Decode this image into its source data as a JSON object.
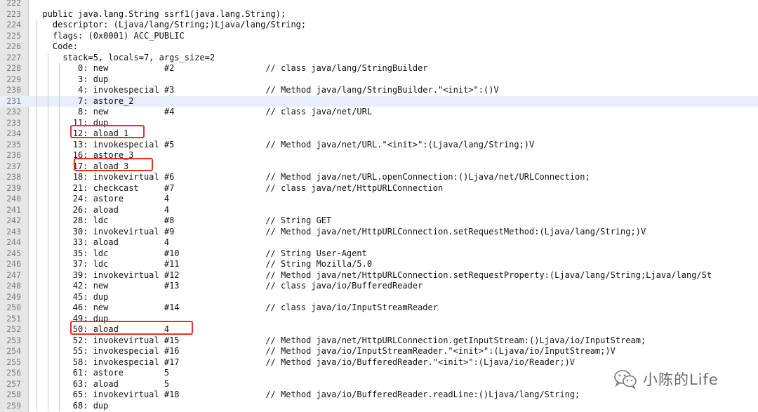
{
  "editor": {
    "lines": [
      {
        "num": "222",
        "text": ""
      },
      {
        "num": "223",
        "text": "  public java.lang.String ssrf1(java.lang.String);"
      },
      {
        "num": "224",
        "text": "    descriptor: (Ljava/lang/String;)Ljava/lang/String;"
      },
      {
        "num": "225",
        "text": "    flags: (0x0001) ACC_PUBLIC"
      },
      {
        "num": "226",
        "text": "    Code:"
      },
      {
        "num": "227",
        "text": "      stack=5, locals=7, args_size=2"
      },
      {
        "num": "228",
        "text": "         0: new           #2                  // class java/lang/StringBuilder"
      },
      {
        "num": "229",
        "text": "         3: dup"
      },
      {
        "num": "230",
        "text": "         4: invokespecial #3                  // Method java/lang/StringBuilder.\"<init>\":()V"
      },
      {
        "num": "231",
        "text": "         7: astore_2"
      },
      {
        "num": "232",
        "text": "         8: new           #4                  // class java/net/URL"
      },
      {
        "num": "233",
        "text": "        11: dup"
      },
      {
        "num": "234",
        "text": "        12: aload_1"
      },
      {
        "num": "235",
        "text": "        13: invokespecial #5                  // Method java/net/URL.\"<init>\":(Ljava/lang/String;)V"
      },
      {
        "num": "236",
        "text": "        16: astore_3"
      },
      {
        "num": "237",
        "text": "        17: aload_3"
      },
      {
        "num": "238",
        "text": "        18: invokevirtual #6                  // Method java/net/URL.openConnection:()Ljava/net/URLConnection;"
      },
      {
        "num": "239",
        "text": "        21: checkcast     #7                  // class java/net/HttpURLConnection"
      },
      {
        "num": "240",
        "text": "        24: astore        4"
      },
      {
        "num": "241",
        "text": "        26: aload         4"
      },
      {
        "num": "242",
        "text": "        28: ldc           #8                  // String GET"
      },
      {
        "num": "243",
        "text": "        30: invokevirtual #9                  // Method java/net/HttpURLConnection.setRequestMethod:(Ljava/lang/String;)V"
      },
      {
        "num": "244",
        "text": "        33: aload         4"
      },
      {
        "num": "245",
        "text": "        35: ldc           #10                 // String User-Agent"
      },
      {
        "num": "246",
        "text": "        37: ldc           #11                 // String Mozilla/5.0"
      },
      {
        "num": "247",
        "text": "        39: invokevirtual #12                 // Method java/net/HttpURLConnection.setRequestProperty:(Ljava/lang/String;Ljava/lang/St"
      },
      {
        "num": "248",
        "text": "        42: new           #13                 // class java/io/BufferedReader"
      },
      {
        "num": "249",
        "text": "        45: dup"
      },
      {
        "num": "250",
        "text": "        46: new           #14                 // class java/io/InputStreamReader"
      },
      {
        "num": "251",
        "text": "        49: dup"
      },
      {
        "num": "252",
        "text": "        50: aload         4"
      },
      {
        "num": "253",
        "text": "        52: invokevirtual #15                 // Method java/net/HttpURLConnection.getInputStream:()Ljava/io/InputStream;"
      },
      {
        "num": "254",
        "text": "        55: invokespecial #16                 // Method java/io/InputStreamReader.\"<init>\":(Ljava/io/InputStream;)V"
      },
      {
        "num": "255",
        "text": "        58: invokespecial #17                 // Method java/io/BufferedReader.\"<init>\":(Ljava/io/Reader;)V"
      },
      {
        "num": "256",
        "text": "        61: astore        5"
      },
      {
        "num": "257",
        "text": "        63: aload         5"
      },
      {
        "num": "258",
        "text": "        65: invokevirtual #18                 // Method java/io/BufferedReader.readLine:()Ljava/lang/String;"
      },
      {
        "num": "259",
        "text": "        68: dup"
      }
    ],
    "current_line": "231"
  },
  "watermark": {
    "text": "小陈的Life",
    "icon": "wechat-icon"
  },
  "colors": {
    "highlight_box": "#e8302a",
    "current_line_bg": "#e8eefb",
    "gutter_bg": "#e6e6e6"
  }
}
